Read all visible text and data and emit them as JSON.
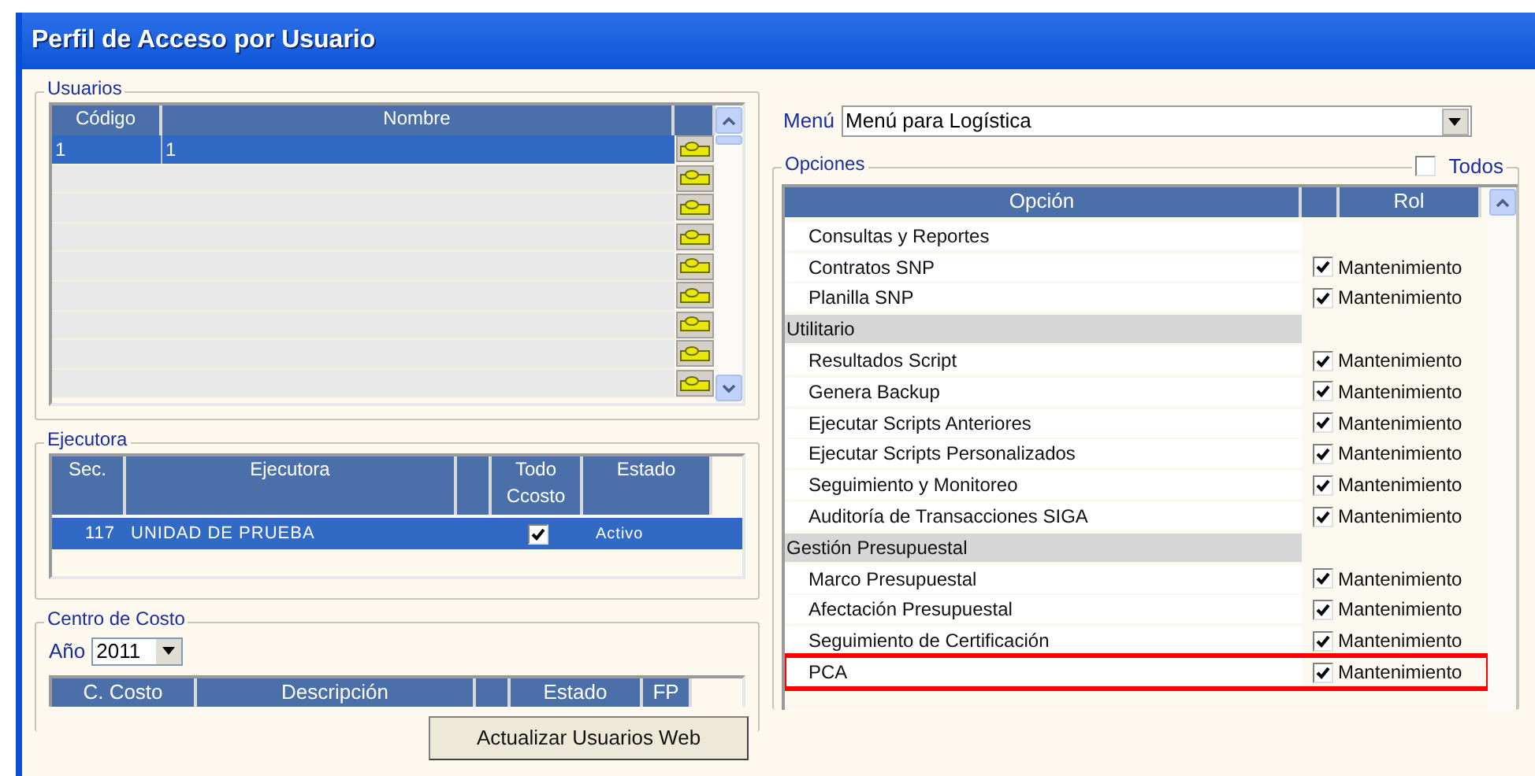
{
  "window": {
    "title": "Perfil de Acceso por Usuario"
  },
  "usuarios": {
    "legend": "Usuarios",
    "columns": [
      "Código",
      "Nombre"
    ],
    "rows": [
      {
        "codigo": "1",
        "nombre": "1",
        "selected": true
      }
    ]
  },
  "ejecutora": {
    "legend": "Ejecutora",
    "columns": [
      "Sec.",
      "Ejecutora",
      "Todo Ccosto",
      "Estado"
    ],
    "rows": [
      {
        "sec": "117",
        "ejecutora": "UNIDAD DE PRUEBA",
        "todo_ccosto": true,
        "estado": "Activo",
        "selected": true
      }
    ]
  },
  "centro_costo": {
    "legend": "Centro de Costo",
    "year_label": "Año",
    "year": "2011",
    "columns": [
      "C. Costo",
      "Descripción",
      "Estado",
      "FP"
    ]
  },
  "update_button": {
    "label": "Actualizar Usuarios Web"
  },
  "menu": {
    "label": "Menú",
    "value": "Menú para Logística"
  },
  "opciones": {
    "legend": "Opciones",
    "todos": {
      "label": "Todos",
      "checked": false
    },
    "columns": [
      "Opción",
      "Rol"
    ],
    "rows": [
      {
        "kind": "item",
        "label": "Consultas y Reportes",
        "children": [
          {
            "kind": "item",
            "label": "Contratos SNP",
            "checked": true,
            "role": "Mantenimiento",
            "highlighted": false
          },
          {
            "kind": "item",
            "label": "Planilla SNP",
            "checked": true,
            "role": "Mantenimiento",
            "highlighted": false
          }
        ]
      },
      {
        "kind": "group",
        "label": "Utilitario",
        "children": [
          {
            "kind": "item",
            "label": "Resultados Script",
            "checked": true,
            "role": "Mantenimiento",
            "highlighted": false
          },
          {
            "kind": "item",
            "label": "Genera Backup",
            "checked": true,
            "role": "Mantenimiento",
            "highlighted": false
          },
          {
            "kind": "item",
            "label": "Ejecutar Scripts Anteriores",
            "checked": true,
            "role": "Mantenimiento",
            "highlighted": false
          },
          {
            "kind": "item",
            "label": "Ejecutar Scripts Personalizados",
            "checked": true,
            "role": "Mantenimiento",
            "highlighted": false
          },
          {
            "kind": "item",
            "label": "Seguimiento y Monitoreo",
            "checked": true,
            "role": "Mantenimiento",
            "highlighted": false
          },
          {
            "kind": "item",
            "label": "Auditoría de Transacciones SIGA",
            "checked": true,
            "role": "Mantenimiento",
            "highlighted": false
          }
        ]
      },
      {
        "kind": "group",
        "label": "Gestión Presupuestal",
        "children": [
          {
            "kind": "item",
            "label": "Marco Presupuestal",
            "checked": true,
            "role": "Mantenimiento",
            "highlighted": false
          },
          {
            "kind": "item",
            "label": "Afectación Presupuestal",
            "checked": true,
            "role": "Mantenimiento",
            "highlighted": false
          },
          {
            "kind": "item",
            "label": "Seguimiento de Certificación",
            "checked": true,
            "role": "Mantenimiento",
            "highlighted": false
          },
          {
            "kind": "item",
            "label": "PCA",
            "checked": true,
            "role": "Mantenimiento",
            "highlighted": true
          }
        ]
      }
    ]
  }
}
